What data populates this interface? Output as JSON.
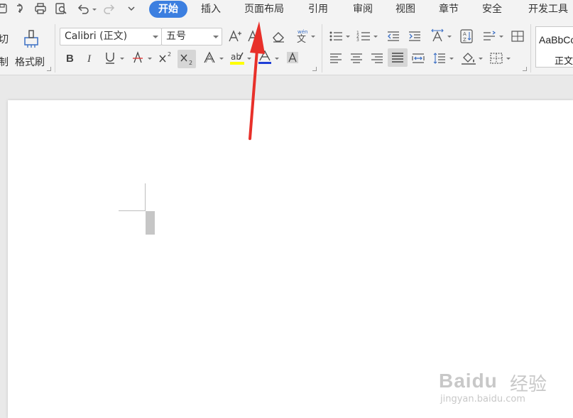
{
  "menubar": {
    "tabs": [
      {
        "label": "开始",
        "active": true
      },
      {
        "label": "插入"
      },
      {
        "label": "页面布局"
      },
      {
        "label": "引用"
      },
      {
        "label": "审阅"
      },
      {
        "label": "视图"
      },
      {
        "label": "章节"
      },
      {
        "label": "安全"
      },
      {
        "label": "开发工具"
      }
    ],
    "active_color": "#3c7fe0",
    "quick_access_icons": [
      "save-icon",
      "export-icon",
      "print-icon",
      "print-preview-icon",
      "undo-icon",
      "redo-icon",
      "customize-icon"
    ]
  },
  "ribbon": {
    "clipboard": {
      "cut_label": "切",
      "copy_label": "制",
      "format_painter_label": "格式刷"
    },
    "font": {
      "font_name": "Calibri (正文)",
      "font_size": "五号",
      "highlight_color": "#ffff00",
      "font_color": "#1f3fd6"
    },
    "styles": {
      "sample_text": "AaBbCc",
      "style_name": "正文"
    }
  },
  "watermark": {
    "logo": "Baidu",
    "text": "经验",
    "url": "jingyan.baidu.com"
  }
}
